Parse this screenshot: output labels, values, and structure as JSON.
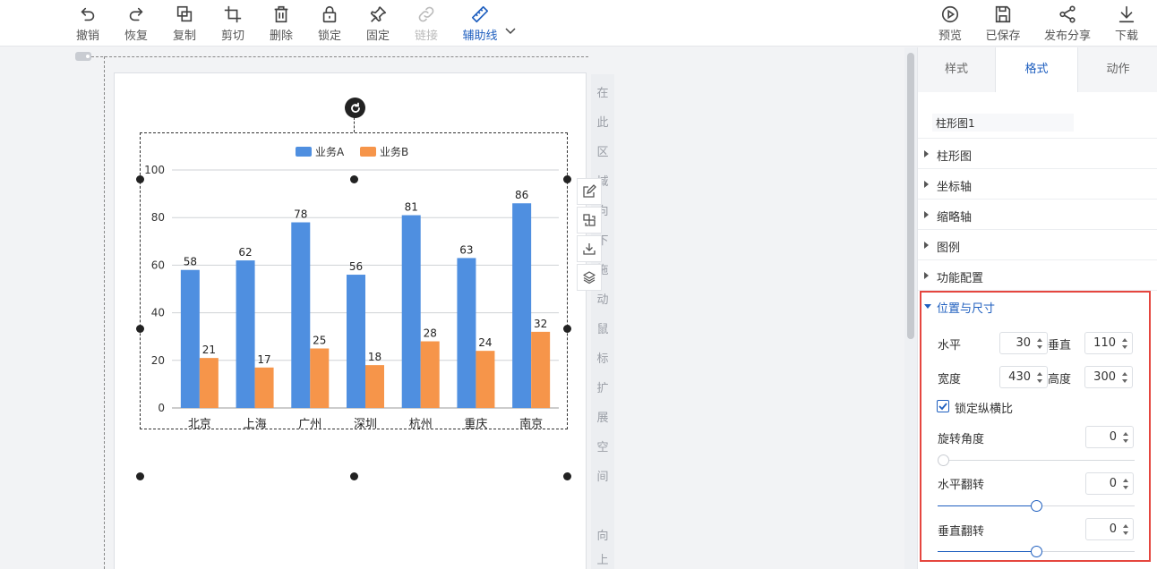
{
  "toolbar": {
    "items": [
      {
        "label": "撤销",
        "icon": "undo-icon"
      },
      {
        "label": "恢复",
        "icon": "redo-icon"
      },
      {
        "label": "复制",
        "icon": "copy-icon"
      },
      {
        "label": "剪切",
        "icon": "crop-icon"
      },
      {
        "label": "删除",
        "icon": "trash-icon"
      },
      {
        "label": "锁定",
        "icon": "lock-icon"
      },
      {
        "label": "固定",
        "icon": "pin-icon"
      },
      {
        "label": "链接",
        "icon": "link-icon"
      },
      {
        "label": "辅助线",
        "icon": "ruler-icon"
      }
    ],
    "right_items": [
      {
        "label": "预览",
        "icon": "play-icon"
      },
      {
        "label": "已保存",
        "icon": "save-icon"
      },
      {
        "label": "发布分享",
        "icon": "share-icon"
      },
      {
        "label": "下载",
        "icon": "download-icon"
      }
    ],
    "active_color": "#1f5fbf"
  },
  "canvas": {
    "hint_chars": [
      "在",
      "此",
      "区",
      "域",
      "向",
      "下",
      "拖",
      "动",
      "鼠",
      "标",
      "扩",
      "展",
      "空",
      "间"
    ],
    "hint_chars_bottom": [
      "向",
      "上"
    ],
    "side_tools": [
      "edit-icon",
      "duplicate-icon",
      "export-icon",
      "layers-icon"
    ]
  },
  "chart_data": {
    "type": "bar",
    "categories": [
      "北京",
      "上海",
      "广州",
      "深圳",
      "杭州",
      "重庆",
      "南京"
    ],
    "series": [
      {
        "name": "业务A",
        "values": [
          58,
          62,
          78,
          56,
          81,
          63,
          86
        ],
        "color": "#4f8fe0"
      },
      {
        "name": "业务B",
        "values": [
          21,
          17,
          25,
          18,
          28,
          24,
          32
        ],
        "color": "#f6954a"
      }
    ],
    "ylim": [
      0,
      100
    ],
    "yticks": [
      0,
      20,
      40,
      60,
      80,
      100
    ],
    "grid": true,
    "legend": "top-center",
    "data_labels": true
  },
  "panel": {
    "tabs": [
      "样式",
      "格式",
      "动作"
    ],
    "active_tab": "格式",
    "component_name": "柱形图1",
    "sections": [
      "柱形图",
      "坐标轴",
      "缩略轴",
      "图例",
      "功能配置"
    ],
    "open_section": "位置与尺寸",
    "position": {
      "h_label": "水平",
      "h_value": "30",
      "v_label": "垂直",
      "v_value": "110",
      "w_label": "宽度",
      "w_value": "430",
      "ht_label": "高度",
      "ht_value": "300"
    },
    "lock_ratio": {
      "label": "锁定纵横比",
      "checked": true
    },
    "rotation": {
      "label": "旋转角度",
      "value": "0",
      "slider": 0
    },
    "flip_h": {
      "label": "水平翻转",
      "value": "0",
      "slider": 0.5
    },
    "flip_v": {
      "label": "垂直翻转",
      "value": "0",
      "slider": 0.5
    }
  }
}
